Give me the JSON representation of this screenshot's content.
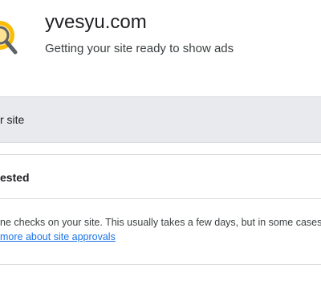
{
  "header": {
    "icon": "magnifier-icon",
    "accent_color": "#fbbc04",
    "site_name": "yvesyu.com",
    "subtitle": "Getting your site ready to show ads"
  },
  "steps": [
    {
      "label": "r site"
    },
    {
      "label": "ested"
    }
  ],
  "info": {
    "text": "ne checks on your site. This usually takes a few days, but in some cases c",
    "link": "more about site approvals"
  }
}
